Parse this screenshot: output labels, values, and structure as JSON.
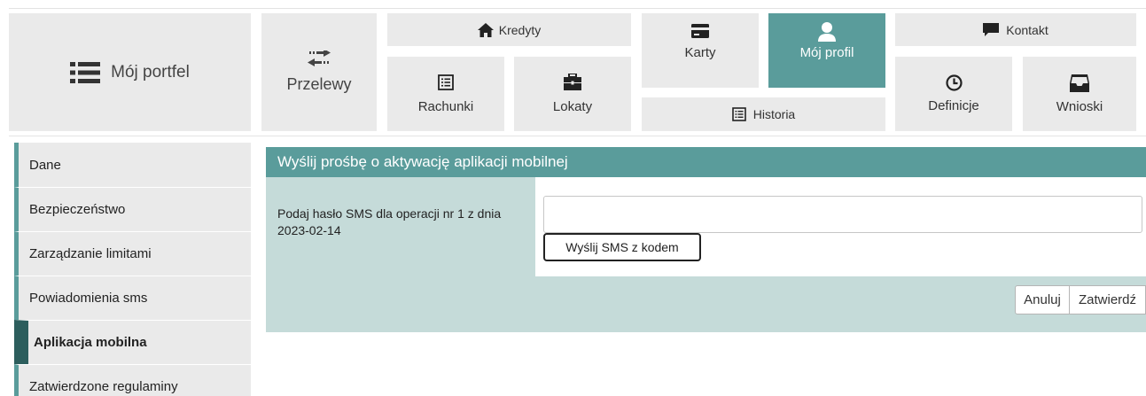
{
  "nav": {
    "portfel": "Mój portfel",
    "przelewy": "Przelewy",
    "kredyty": "Kredyty",
    "rachunki": "Rachunki",
    "lokaty": "Lokaty",
    "karty": "Karty",
    "moj_profil": "Mój profil",
    "historia": "Historia",
    "kontakt": "Kontakt",
    "definicje": "Definicje",
    "wnioski": "Wnioski",
    "active": "Mój profil"
  },
  "sidebar": {
    "items": [
      {
        "label": "Dane"
      },
      {
        "label": "Bezpieczeństwo"
      },
      {
        "label": "Zarządzanie limitami"
      },
      {
        "label": "Powiadomienia sms"
      },
      {
        "label": "Aplikacja mobilna",
        "active": true
      },
      {
        "label": "Zatwierdzone regulaminy"
      }
    ]
  },
  "panel": {
    "title": "Wyślij prośbę o aktywację aplikacji mobilnej",
    "field_label": "Podaj hasło SMS dla operacji nr 1 z dnia 2023-02-14",
    "field_value": "",
    "send_sms_label": "Wyślij SMS z kodem",
    "cancel_label": "Anuluj",
    "confirm_label": "Zatwierdź"
  },
  "colors": {
    "accent": "#5a9c9b",
    "accent_dark": "#2d5e5d",
    "tile_bg": "#eaeaea",
    "panel_row_bg": "#c5dbd9"
  },
  "icons": {
    "portfel": "list-icon",
    "przelewy": "transfer-arrows-icon",
    "kredyty": "home-icon",
    "rachunki": "document-list-icon",
    "lokaty": "briefcase-icon",
    "karty": "credit-card-icon",
    "moj_profil": "user-icon",
    "historia": "history-list-icon",
    "kontakt": "chat-bubble-icon",
    "definicje": "clock-icon",
    "wnioski": "inbox-tray-icon"
  }
}
